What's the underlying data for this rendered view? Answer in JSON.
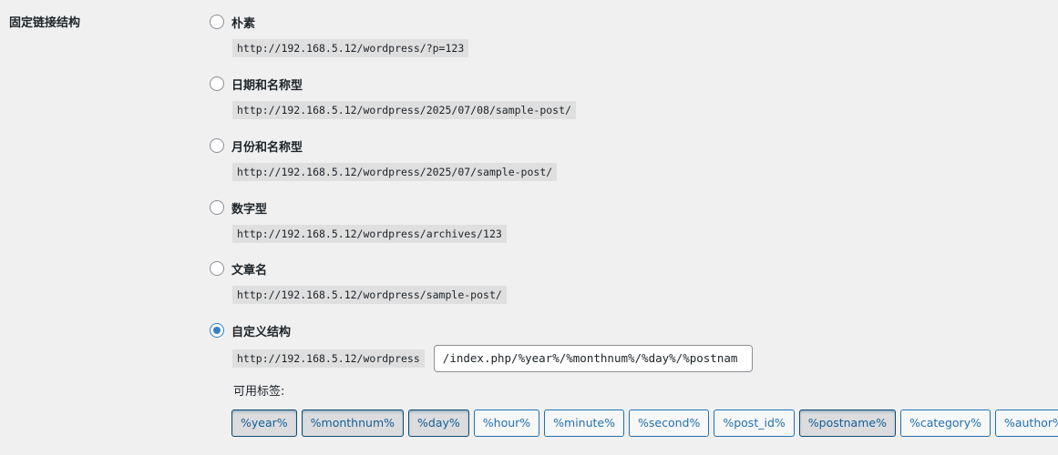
{
  "section_label": "固定链接结构",
  "options": [
    {
      "title": "朴素",
      "url": "http://192.168.5.12/wordpress/?p=123",
      "checked": false
    },
    {
      "title": "日期和名称型",
      "url": "http://192.168.5.12/wordpress/2025/07/08/sample-post/",
      "checked": false
    },
    {
      "title": "月份和名称型",
      "url": "http://192.168.5.12/wordpress/2025/07/sample-post/",
      "checked": false
    },
    {
      "title": "数字型",
      "url": "http://192.168.5.12/wordpress/archives/123",
      "checked": false
    },
    {
      "title": "文章名",
      "url": "http://192.168.5.12/wordpress/sample-post/",
      "checked": false
    },
    {
      "title": "自定义结构",
      "checked": true
    }
  ],
  "custom": {
    "base_url": "http://192.168.5.12/wordpress",
    "structure_value": "/index.php/%year%/%monthnum%/%day%/%postnam"
  },
  "tags_label": "可用标签:",
  "tags": [
    {
      "label": "%year%",
      "active": true
    },
    {
      "label": "%monthnum%",
      "active": true
    },
    {
      "label": "%day%",
      "active": true
    },
    {
      "label": "%hour%",
      "active": false
    },
    {
      "label": "%minute%",
      "active": false
    },
    {
      "label": "%second%",
      "active": false
    },
    {
      "label": "%post_id%",
      "active": false
    },
    {
      "label": "%postname%",
      "active": true
    },
    {
      "label": "%category%",
      "active": false
    },
    {
      "label": "%author%",
      "active": false
    }
  ],
  "colors": {
    "background": "#f0f0f1",
    "accent": "#2271b1",
    "radio_checked": "#3582c4"
  }
}
